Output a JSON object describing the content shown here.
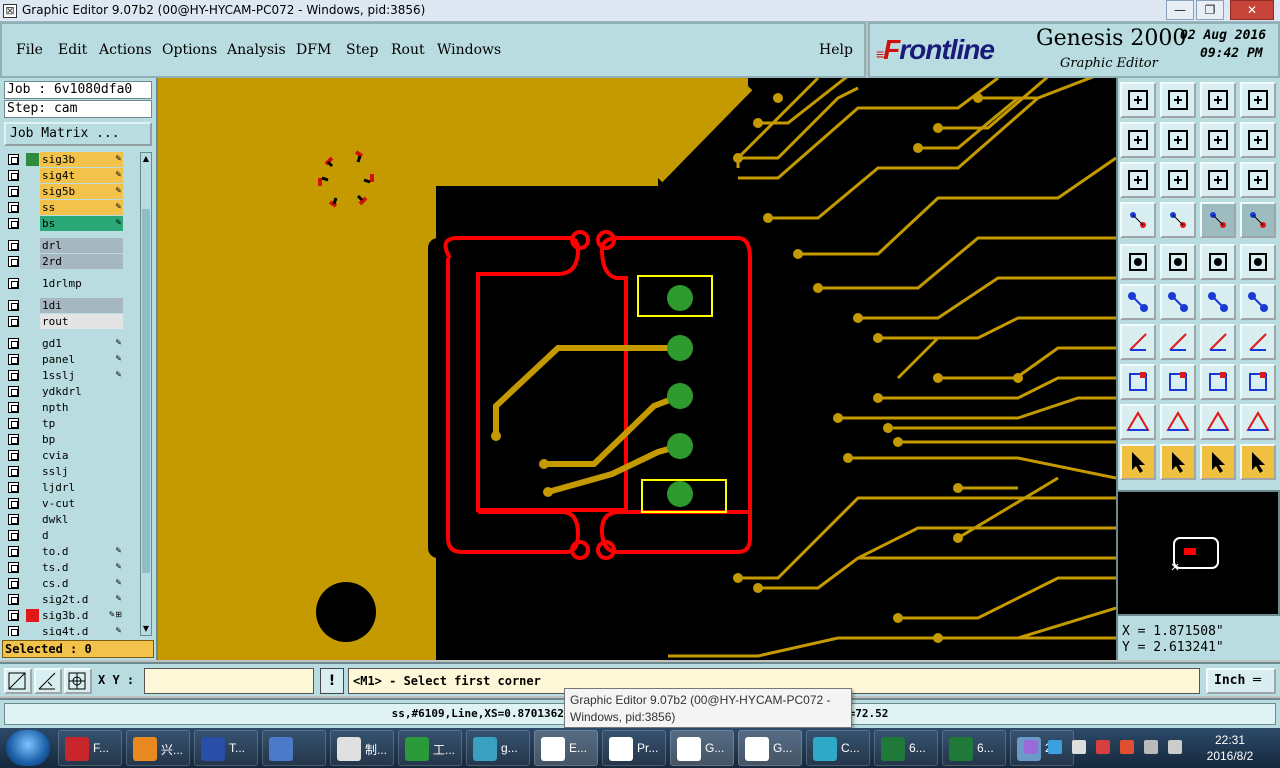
{
  "window": {
    "title": "Graphic Editor 9.07b2 (00@HY-HYCAM-PC072 - Windows, pid:3856)",
    "min": "—",
    "max": "❐",
    "close": "✕"
  },
  "menu": [
    "File",
    "Edit",
    "Actions",
    "Options",
    "Analysis",
    "DFM",
    "Step",
    "Rout",
    "Windows"
  ],
  "help": "Help",
  "brand": {
    "logo_f": "F",
    "logo_rest": "rontline",
    "product": "Genesis 2000",
    "subtitle": "Graphic Editor",
    "date": "02 Aug 2016",
    "time": "09:42 PM"
  },
  "job": {
    "job_line": "Job : 6v1080dfa0",
    "step_line": "Step: cam",
    "matrix_button": "Job Matrix ..."
  },
  "layers": [
    {
      "name": "sig3b",
      "color": "#f2c24a",
      "swatch": "#2e8b3e",
      "flag": "✎"
    },
    {
      "name": "sig4t",
      "color": "#f2c24a",
      "swatch": "#b8dce0",
      "flag": "✎"
    },
    {
      "name": "sig5b",
      "color": "#f2c24a",
      "swatch": "#b8dce0",
      "flag": "✎"
    },
    {
      "name": "ss",
      "color": "#f2c24a",
      "swatch": "#b8dce0",
      "flag": "✎"
    },
    {
      "name": "bs",
      "color": "#2aa878",
      "swatch": "#b8dce0",
      "flag": "✎"
    },
    {
      "name": "drl",
      "color": "#a7b7c2",
      "swatch": "#b8dce0",
      "flag": ""
    },
    {
      "name": "2rd",
      "color": "#a7b7c2",
      "swatch": "#b8dce0",
      "flag": ""
    },
    {
      "name": "1drlmp",
      "color": "#b8dce0",
      "swatch": "#b8dce0",
      "flag": ""
    },
    {
      "name": "1di",
      "color": "#a7b7c2",
      "swatch": "#b8dce0",
      "flag": ""
    },
    {
      "name": "rout",
      "color": "#e4e4e4",
      "swatch": "#b8dce0",
      "flag": ""
    },
    {
      "name": "gd1",
      "color": "#b8dce0",
      "swatch": "#b8dce0",
      "flag": "✎"
    },
    {
      "name": "panel",
      "color": "#b8dce0",
      "swatch": "#b8dce0",
      "flag": "✎"
    },
    {
      "name": "1sslj",
      "color": "#b8dce0",
      "swatch": "#b8dce0",
      "flag": "✎"
    },
    {
      "name": "ydkdrl",
      "color": "#b8dce0",
      "swatch": "#b8dce0",
      "flag": ""
    },
    {
      "name": "npth",
      "color": "#b8dce0",
      "swatch": "#b8dce0",
      "flag": ""
    },
    {
      "name": "tp",
      "color": "#b8dce0",
      "swatch": "#b8dce0",
      "flag": ""
    },
    {
      "name": "bp",
      "color": "#b8dce0",
      "swatch": "#b8dce0",
      "flag": ""
    },
    {
      "name": "cvia",
      "color": "#b8dce0",
      "swatch": "#b8dce0",
      "flag": ""
    },
    {
      "name": "sslj",
      "color": "#b8dce0",
      "swatch": "#b8dce0",
      "flag": ""
    },
    {
      "name": "ljdrl",
      "color": "#b8dce0",
      "swatch": "#b8dce0",
      "flag": ""
    },
    {
      "name": "v-cut",
      "color": "#b8dce0",
      "swatch": "#b8dce0",
      "flag": ""
    },
    {
      "name": "dwkl",
      "color": "#b8dce0",
      "swatch": "#b8dce0",
      "flag": ""
    },
    {
      "name": "d",
      "color": "#b8dce0",
      "swatch": "#b8dce0",
      "flag": ""
    },
    {
      "name": "to.d",
      "color": "#b8dce0",
      "swatch": "#b8dce0",
      "flag": "✎"
    },
    {
      "name": "ts.d",
      "color": "#b8dce0",
      "swatch": "#b8dce0",
      "flag": "✎"
    },
    {
      "name": "cs.d",
      "color": "#b8dce0",
      "swatch": "#b8dce0",
      "flag": "✎"
    },
    {
      "name": "sig2t.d",
      "color": "#b8dce0",
      "swatch": "#b8dce0",
      "flag": "✎"
    },
    {
      "name": "sig3b.d",
      "color": "#b8dce0",
      "swatch": "#e01818",
      "flag": "✎⊞"
    },
    {
      "name": "sig4t.d",
      "color": "#b8dce0",
      "swatch": "#b8dce0",
      "flag": "✎"
    }
  ],
  "selected": "Selected : 0",
  "coords": {
    "x": "X = 1.871508\"",
    "y": "Y = 2.613241\""
  },
  "cmd": {
    "xy_label": "X Y :",
    "xy_value": "",
    "bang": "!",
    "prompt": "<M1> - Select first corner",
    "units": "Inch ═"
  },
  "status": "ss,#6109,Line,XS=0.8701362,YS=2.6118488,XE=0.8701362,YE=2.6118488,Ang=72.52",
  "tooltip": "Graphic Editor 9.07b2 (00@HY-HYCAM-PC072 - Windows, pid:3856)",
  "taskbar": {
    "tasks": [
      {
        "label": "F...",
        "color": "#c8262a"
      },
      {
        "label": "兴...",
        "color": "#e88a20"
      },
      {
        "label": "T...",
        "color": "#2a4fa8"
      },
      {
        "label": "",
        "color": "#4a7ac8"
      },
      {
        "label": "制...",
        "color": "#e0e0e0"
      },
      {
        "label": "工...",
        "color": "#2a9a3a"
      },
      {
        "label": "g...",
        "color": "#3aa0c0"
      },
      {
        "label": "E...",
        "color": "#ffffff"
      },
      {
        "label": "Pr...",
        "color": "#ffffff"
      },
      {
        "label": "G...",
        "color": "#ffffff"
      },
      {
        "label": "G...",
        "color": "#ffffff"
      },
      {
        "label": "C...",
        "color": "#30a8c8"
      },
      {
        "label": "6...",
        "color": "#1f7a3a"
      },
      {
        "label": "6...",
        "color": "#1f7a3a"
      },
      {
        "label": "2...",
        "color": "#6a9ac8"
      }
    ],
    "clock_time": "22:31",
    "clock_date": "2016/8/2"
  }
}
